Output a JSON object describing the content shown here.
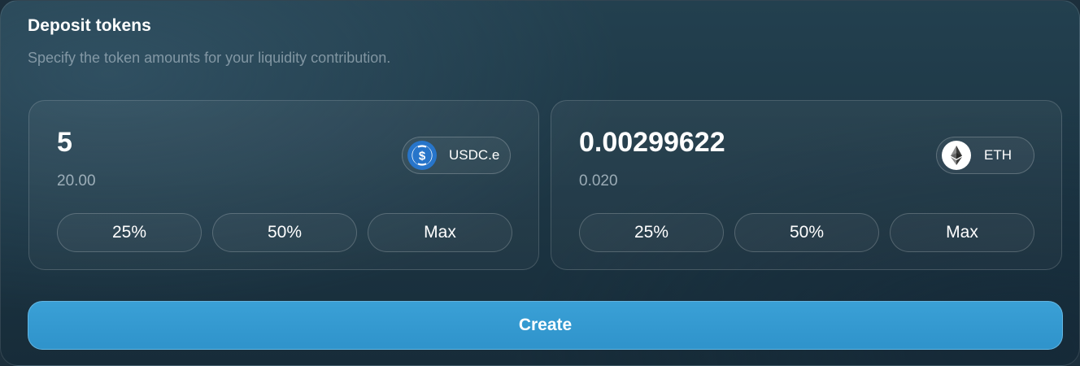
{
  "deposit": {
    "title": "Deposit tokens",
    "subtitle": "Specify the token amounts for your liquidity contribution."
  },
  "tokens": [
    {
      "amount": "5",
      "usd_value": "20.00",
      "symbol": "USDC.e",
      "icon": "usdc-icon",
      "icon_color": "#2775ca",
      "percent_buttons": [
        "25%",
        "50%",
        "Max"
      ]
    },
    {
      "amount": "0.00299622",
      "usd_value": "0.020",
      "symbol": "ETH",
      "icon": "eth-icon",
      "icon_color": "#ffffff",
      "percent_buttons": [
        "25%",
        "50%",
        "Max"
      ]
    }
  ],
  "actions": {
    "create_label": "Create"
  },
  "colors": {
    "accent": "#2f93cb",
    "text_primary": "#ffffff",
    "text_muted": "#8fa3ad"
  }
}
